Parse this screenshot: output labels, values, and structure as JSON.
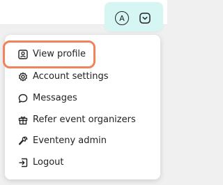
{
  "header": {
    "avatar_initial": "A",
    "chip_color": "#d6f6f4"
  },
  "menu": {
    "items": [
      {
        "label": "View profile",
        "icon": "profile-card-icon"
      },
      {
        "label": "Account settings",
        "icon": "gear-icon"
      },
      {
        "label": "Messages",
        "icon": "chat-bubble-icon"
      },
      {
        "label": "Refer event organizers",
        "icon": "gift-icon"
      },
      {
        "label": "Eventeny admin",
        "icon": "wrench-icon"
      },
      {
        "label": "Logout",
        "icon": "logout-icon"
      }
    ],
    "highlighted_item": "View profile",
    "highlight_color": "#f0835a"
  }
}
